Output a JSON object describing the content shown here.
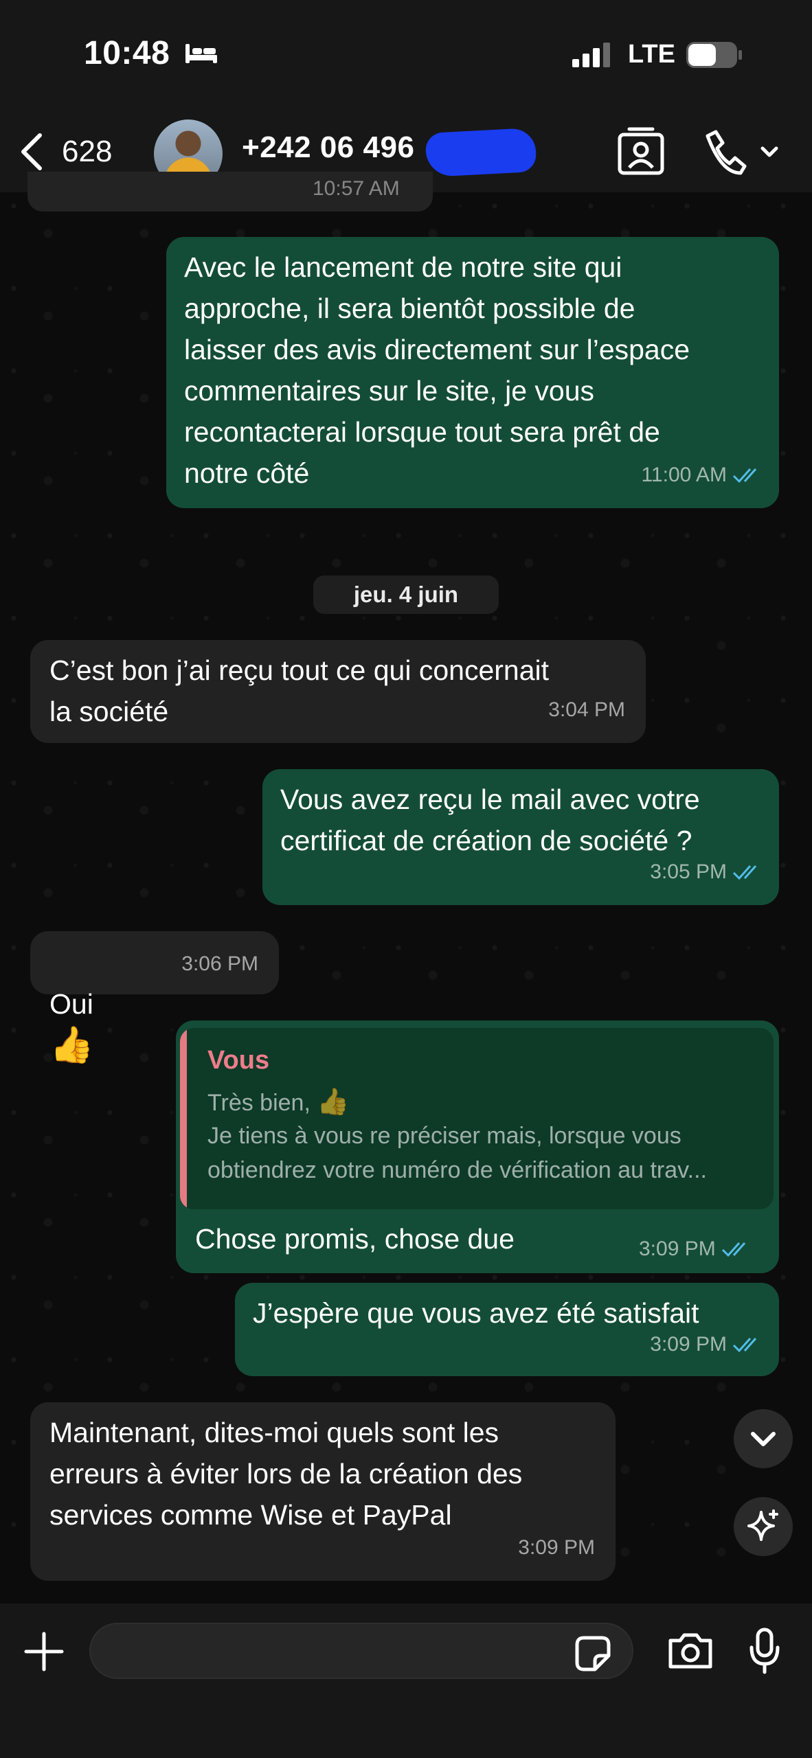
{
  "status_bar": {
    "time": "10:48",
    "network": "LTE"
  },
  "header": {
    "back_count": "628",
    "contact_name": "+242 06 496"
  },
  "partial_time": "10:57 AM",
  "messages": {
    "m1": {
      "text": "Avec le lancement de notre site qui\napproche, il sera bientôt possible de\nlaisser des avis directement sur l’espace\ncommentaires sur le site, je vous\nrecontacterai lorsque tout sera prêt de\nnotre côté",
      "time": "11:00 AM"
    },
    "date_separator": "jeu. 4 juin",
    "m2": {
      "text": "C’est bon j’ai reçu tout ce qui concernait\nla société",
      "time": "3:04 PM"
    },
    "m3": {
      "text": "Vous avez reçu le mail avec votre\ncertificat de création de société ?",
      "time": "3:05 PM"
    },
    "m4": {
      "text": "Oui",
      "emoji": "👍",
      "time": "3:06 PM"
    },
    "m5": {
      "quote_author": "Vous",
      "quote_line1": "Très bien,",
      "quote_emoji": "👍",
      "quote_line2": "Je tiens à vous re préciser mais, lorsque vous",
      "quote_line3": "obtiendrez votre numéro de vérification au trav...",
      "text": "Chose promis, chose due",
      "time": "3:09 PM"
    },
    "m6": {
      "text": "J’espère que vous avez été satisfait",
      "time": "3:09 PM"
    },
    "m7": {
      "text": "Maintenant, dites-moi quels sont les\nerreurs à éviter lors de la création des\nservices comme Wise  et PayPal",
      "time": "3:09 PM"
    }
  },
  "colors": {
    "outgoing_bubble": "#144d37",
    "incoming_bubble": "#222222",
    "read_checks": "#53bdeb",
    "quote_accent": "#e47b83"
  },
  "icons": [
    "bed-icon",
    "signal-icon",
    "battery-icon",
    "back-chevron-icon",
    "contact-card-icon",
    "phone-icon",
    "chevron-down-icon",
    "double-check-icon",
    "sparkle-icon",
    "plus-icon",
    "sticker-icon",
    "camera-icon",
    "microphone-icon"
  ]
}
